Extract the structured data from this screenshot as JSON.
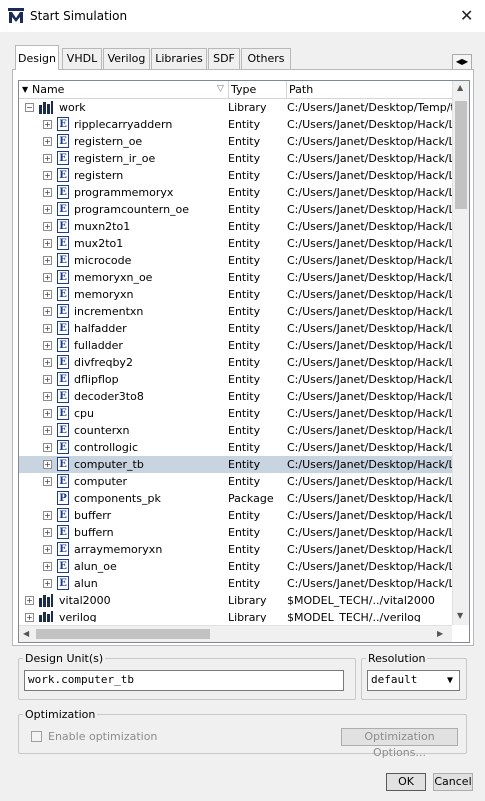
{
  "window": {
    "title": "Start Simulation",
    "close_icon": "close-icon"
  },
  "tabs": [
    {
      "label": "Design"
    },
    {
      "label": "VHDL"
    },
    {
      "label": "Verilog"
    },
    {
      "label": "Libraries"
    },
    {
      "label": "SDF"
    },
    {
      "label": "Others"
    }
  ],
  "columns": {
    "name": "Name",
    "type": "Type",
    "path": "Path"
  },
  "rows": [
    {
      "name": "work",
      "type": "Library",
      "path": "C:/Users/Janet/Desktop/Temp/tt/",
      "kind": "library",
      "expanded": true
    },
    {
      "name": "ripplecarryaddern",
      "type": "Entity",
      "path": "C:/Users/Janet/Desktop/Hack/Lea",
      "kind": "entity"
    },
    {
      "name": "registern_oe",
      "type": "Entity",
      "path": "C:/Users/Janet/Desktop/Hack/Lea",
      "kind": "entity"
    },
    {
      "name": "registern_ir_oe",
      "type": "Entity",
      "path": "C:/Users/Janet/Desktop/Hack/Lea",
      "kind": "entity"
    },
    {
      "name": "registern",
      "type": "Entity",
      "path": "C:/Users/Janet/Desktop/Hack/Lea",
      "kind": "entity"
    },
    {
      "name": "programmemoryx",
      "type": "Entity",
      "path": "C:/Users/Janet/Desktop/Hack/Lea",
      "kind": "entity"
    },
    {
      "name": "programcountern_oe",
      "type": "Entity",
      "path": "C:/Users/Janet/Desktop/Hack/Lea",
      "kind": "entity"
    },
    {
      "name": "muxn2to1",
      "type": "Entity",
      "path": "C:/Users/Janet/Desktop/Hack/Lea",
      "kind": "entity"
    },
    {
      "name": "mux2to1",
      "type": "Entity",
      "path": "C:/Users/Janet/Desktop/Hack/Lea",
      "kind": "entity"
    },
    {
      "name": "microcode",
      "type": "Entity",
      "path": "C:/Users/Janet/Desktop/Hack/Lea",
      "kind": "entity"
    },
    {
      "name": "memoryxn_oe",
      "type": "Entity",
      "path": "C:/Users/Janet/Desktop/Hack/Lea",
      "kind": "entity"
    },
    {
      "name": "memoryxn",
      "type": "Entity",
      "path": "C:/Users/Janet/Desktop/Hack/Lea",
      "kind": "entity"
    },
    {
      "name": "incrementxn",
      "type": "Entity",
      "path": "C:/Users/Janet/Desktop/Hack/Lea",
      "kind": "entity"
    },
    {
      "name": "halfadder",
      "type": "Entity",
      "path": "C:/Users/Janet/Desktop/Hack/Lea",
      "kind": "entity"
    },
    {
      "name": "fulladder",
      "type": "Entity",
      "path": "C:/Users/Janet/Desktop/Hack/Lea",
      "kind": "entity"
    },
    {
      "name": "divfreqby2",
      "type": "Entity",
      "path": "C:/Users/Janet/Desktop/Hack/Lea",
      "kind": "entity"
    },
    {
      "name": "dflipflop",
      "type": "Entity",
      "path": "C:/Users/Janet/Desktop/Hack/Lea",
      "kind": "entity"
    },
    {
      "name": "decoder3to8",
      "type": "Entity",
      "path": "C:/Users/Janet/Desktop/Hack/Lea",
      "kind": "entity"
    },
    {
      "name": "cpu",
      "type": "Entity",
      "path": "C:/Users/Janet/Desktop/Hack/Lea",
      "kind": "entity"
    },
    {
      "name": "counterxn",
      "type": "Entity",
      "path": "C:/Users/Janet/Desktop/Hack/Lea",
      "kind": "entity"
    },
    {
      "name": "controllogic",
      "type": "Entity",
      "path": "C:/Users/Janet/Desktop/Hack/Lea",
      "kind": "entity"
    },
    {
      "name": "computer_tb",
      "type": "Entity",
      "path": "C:/Users/Janet/Desktop/Hack/Lea",
      "kind": "entity",
      "selected": true
    },
    {
      "name": "computer",
      "type": "Entity",
      "path": "C:/Users/Janet/Desktop/Hack/Lea",
      "kind": "entity"
    },
    {
      "name": "components_pk",
      "type": "Package",
      "path": "C:/Users/Janet/Desktop/Hack/Lea",
      "kind": "package"
    },
    {
      "name": "bufferr",
      "type": "Entity",
      "path": "C:/Users/Janet/Desktop/Hack/Lea",
      "kind": "entity"
    },
    {
      "name": "buffern",
      "type": "Entity",
      "path": "C:/Users/Janet/Desktop/Hack/Lea",
      "kind": "entity"
    },
    {
      "name": "arraymemoryxn",
      "type": "Entity",
      "path": "C:/Users/Janet/Desktop/Hack/Lea",
      "kind": "entity"
    },
    {
      "name": "alun_oe",
      "type": "Entity",
      "path": "C:/Users/Janet/Desktop/Hack/Lea",
      "kind": "entity"
    },
    {
      "name": "alun",
      "type": "Entity",
      "path": "C:/Users/Janet/Desktop/Hack/Lea",
      "kind": "entity"
    },
    {
      "name": "vital2000",
      "type": "Library",
      "path": "$MODEL_TECH/../vital2000",
      "kind": "library"
    },
    {
      "name": "verilog",
      "type": "Library",
      "path": "$MODEL_TECH/../verilog",
      "kind": "library"
    }
  ],
  "design_unit": {
    "label": "Design Unit(s)",
    "value": "work.computer_tb"
  },
  "resolution": {
    "label": "Resolution",
    "value": "default"
  },
  "optimization": {
    "label": "Optimization",
    "checkbox_label": "Enable optimization",
    "options_button": "Optimization Options..."
  },
  "buttons": {
    "ok": "OK",
    "cancel": "Cancel"
  },
  "colors": {
    "selected_row": "#c8d4df",
    "entity_icon": "#1c3c8c"
  }
}
